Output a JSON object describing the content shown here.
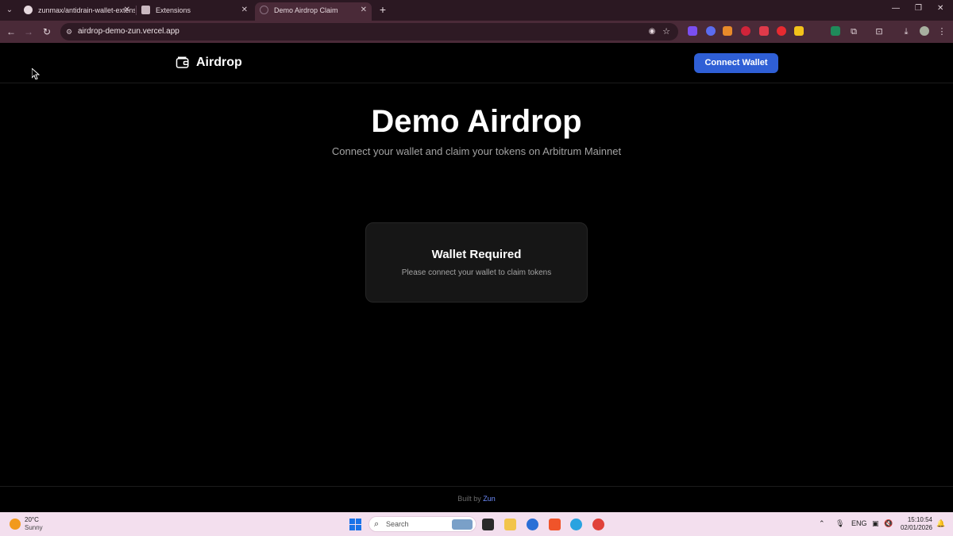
{
  "browser": {
    "tabs": [
      {
        "title": "zunmax/antidrain-wallet-extens",
        "active": false
      },
      {
        "title": "Extensions",
        "active": false
      },
      {
        "title": "Demo Airdrop Claim",
        "active": true
      }
    ],
    "url": "airdrop-demo-zun.vercel.app"
  },
  "page": {
    "brand_name": "Airdrop",
    "connect_label": "Connect Wallet",
    "hero_title": "Demo Airdrop",
    "hero_subtitle": "Connect your wallet and claim your tokens on Arbitrum Mainnet",
    "card": {
      "title": "Wallet Required",
      "text": "Please connect your wallet to claim tokens"
    },
    "footer": {
      "prefix": "Built by",
      "author": "Zun"
    }
  },
  "taskbar": {
    "weather_temp": "20°C",
    "weather_condition": "Sunny",
    "search_placeholder": "Search",
    "language": "ENG",
    "time": "15:10:54",
    "date": "02/01/2026"
  },
  "colors": {
    "accent": "#2f5fd6",
    "footer_link": "#6e8dff",
    "chrome": "#4a2a38"
  }
}
